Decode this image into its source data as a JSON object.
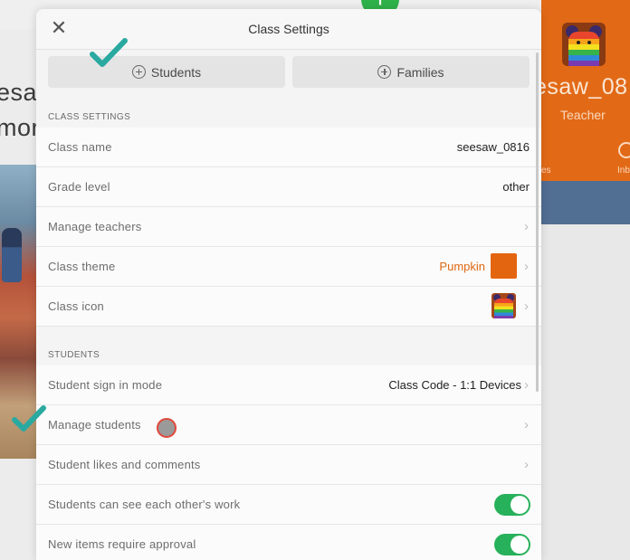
{
  "background": {
    "left_text_1": "esaw",
    "left_text_2": "mor",
    "class_name": "esaw_08",
    "role": "Teacher",
    "tab_a": "es",
    "tab_b": "Inb"
  },
  "modal": {
    "title": "Class Settings",
    "close_icon": "close-icon",
    "invite_students_label": "Students",
    "invite_families_label": "Families"
  },
  "class_settings": {
    "section_label": "CLASS SETTINGS",
    "rows": [
      {
        "label": "Class name",
        "value": "seesaw_0816"
      },
      {
        "label": "Grade level",
        "value": "other"
      },
      {
        "label": "Manage teachers",
        "value": ""
      },
      {
        "label": "Class theme",
        "value": "Pumpkin"
      },
      {
        "label": "Class icon",
        "value": ""
      }
    ]
  },
  "students": {
    "section_label": "STUDENTS",
    "rows": [
      {
        "label": "Student sign in mode",
        "value": "Class Code - 1:1 Devices"
      },
      {
        "label": "Manage students",
        "value": ""
      },
      {
        "label": "Student likes and comments",
        "value": ""
      },
      {
        "label": "Students can see each other's work",
        "toggle": true
      },
      {
        "label": "New items require approval",
        "toggle": true
      }
    ]
  },
  "colors": {
    "theme_accent": "#e46510",
    "toggle_on": "#27b15a",
    "checkmark": "#2aa9a0"
  }
}
